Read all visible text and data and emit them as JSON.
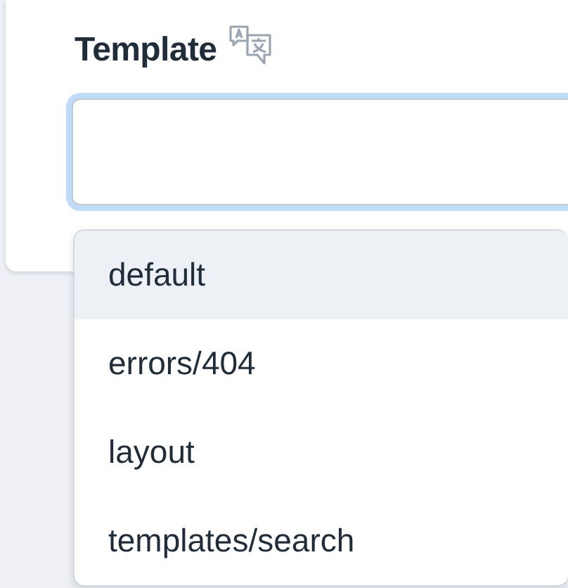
{
  "field": {
    "label": "Template"
  },
  "options": [
    {
      "label": "default",
      "selected": true
    },
    {
      "label": "errors/404",
      "selected": false
    },
    {
      "label": "layout",
      "selected": false
    },
    {
      "label": "templates/search",
      "selected": false
    }
  ]
}
